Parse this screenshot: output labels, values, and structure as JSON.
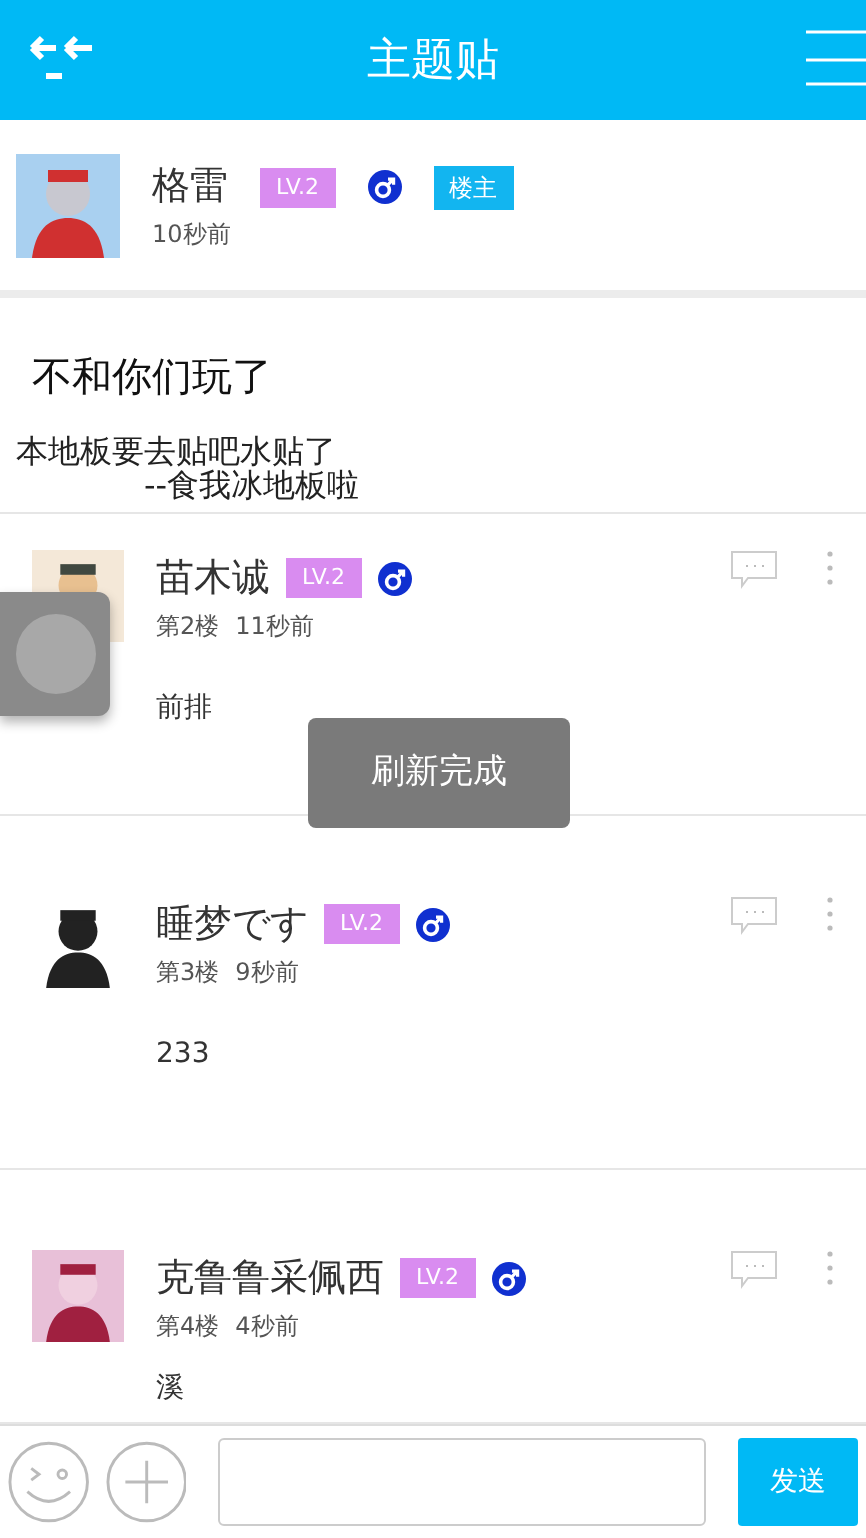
{
  "header": {
    "title": "主题贴"
  },
  "topic": {
    "name": "格雷",
    "level": "LV.2",
    "op_badge": "楼主",
    "time": "10秒前",
    "title": "不和你们玩了",
    "body": [
      "本地板要去贴吧水贴了",
      "--食我冰地板啦"
    ]
  },
  "replies": [
    {
      "name": "苗木诚",
      "level": "LV.2",
      "floor": "第2楼",
      "time": "11秒前",
      "content": "前排"
    },
    {
      "name": "睡梦です",
      "level": "LV.2",
      "floor": "第3楼",
      "time": "9秒前",
      "content": "233"
    },
    {
      "name": "克鲁鲁采佩西",
      "level": "LV.2",
      "floor": "第4楼",
      "time": "4秒前",
      "content": "溪"
    }
  ],
  "toast": "刷新完成",
  "composer": {
    "send": "发送"
  }
}
